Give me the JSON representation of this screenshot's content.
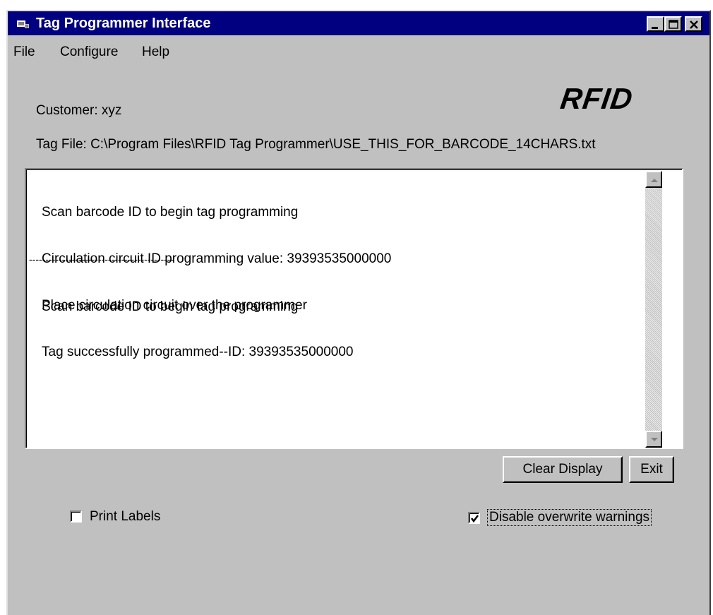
{
  "window": {
    "title": "Tag Programmer Interface",
    "controls": {
      "minimize": "minimize",
      "maximize": "maximize",
      "close": "close"
    }
  },
  "menu": {
    "items": [
      "File",
      "Configure",
      "Help"
    ]
  },
  "logo": {
    "text": "RFID"
  },
  "info": {
    "customer": "Customer: xyz",
    "tag_file": "Tag File: C:\\Program Files\\RFID Tag Programmer\\USE_THIS_FOR_BARCODE_14CHARS.txt"
  },
  "log": {
    "lines_before": [
      "Scan barcode ID to begin tag programming",
      "Circulation circuit ID programming value: 39393535000000",
      "Place circulation circuit over the programmer",
      "Tag successfully programmed--ID: 39393535000000"
    ],
    "separator": "--------------------------------------------",
    "lines_after": [
      "Scan barcode ID to begin tag programming"
    ]
  },
  "buttons": {
    "clear_display": "Clear Display",
    "exit": "Exit"
  },
  "options": {
    "print_labels": {
      "label": "Print Labels",
      "checked": false
    },
    "disable_overwrite": {
      "label": "Disable overwrite warnings",
      "checked": true
    }
  },
  "colors": {
    "titlebar": "#000080",
    "face": "#c0c0c0"
  }
}
